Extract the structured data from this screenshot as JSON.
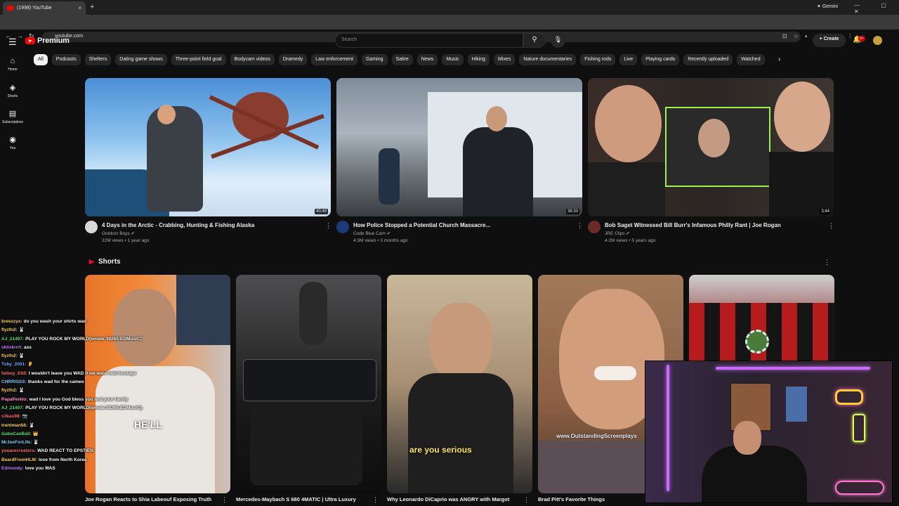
{
  "browser": {
    "tab_title": "(1998) YouTube",
    "tab_close": "×",
    "new_tab": "+",
    "gemini_label": "Gemini",
    "url": "youtube.com",
    "window_controls": "— ▢ ✕"
  },
  "header": {
    "menu_icon": "☰",
    "logo_text": "Premium",
    "search_placeholder": "Search",
    "create_label": "Create",
    "notification_badge": "9+"
  },
  "sidebar": [
    {
      "icon": "⌂",
      "label": "Home"
    },
    {
      "icon": "◈",
      "label": "Shorts"
    },
    {
      "icon": "▤",
      "label": "Subscriptions"
    },
    {
      "icon": "◉",
      "label": "You"
    }
  ],
  "chips": [
    "All",
    "Podcasts",
    "Shelters",
    "Dating game shows",
    "Three-point field goal",
    "Bodycam videos",
    "Dramedy",
    "Law enforcement",
    "Gaming",
    "Satire",
    "News",
    "Music",
    "Hiking",
    "Mixes",
    "Nature documentaries",
    "Fishing rods",
    "Live",
    "Playing cards",
    "Recently uploaded",
    "Watched"
  ],
  "videos": [
    {
      "title": "4 Days in the Arctic - Crabbing, Hunting & Fishing Alaska",
      "channel": "Outdoor Boys",
      "meta": "22M views • 1 year ago",
      "duration": "40:49"
    },
    {
      "title": "How Police Stopped a Potential Church Massacre...",
      "channel": "Code Blue Cam",
      "meta": "4.3M views • 3 months ago",
      "duration": "38:33"
    },
    {
      "title": "Bob Saget Witnessed Bill Burr's Infamous Philly Rant | Joe Rogan",
      "channel": "JRE Clips",
      "meta": "4.2M views • 5 years ago",
      "duration": "3:44"
    }
  ],
  "shorts": {
    "heading": "Shorts",
    "items": [
      {
        "title": "Joe Rogan Reacts to Shia Labeouf Exposing Truth",
        "caption": "HE'LL"
      },
      {
        "title": "Mercedes-Maybach S 680 4MATIC | Ultra Luxury",
        "caption": ""
      },
      {
        "title": "Why Leonardo DiCaprio was ANGRY with Margot",
        "caption": "are you serious"
      },
      {
        "title": "Brad Pitt's Favorite Things",
        "caption": "www.OutstandingScreenplays"
      },
      {
        "title": "",
        "caption": ""
      }
    ]
  },
  "chat": [
    {
      "user": "breezzyx:",
      "color": "#ffd34d",
      "msg": "do you wash your shirts wad"
    },
    {
      "user": "flyzfn2:",
      "color": "#ffd34d",
      "msg": "🐰"
    },
    {
      "user": "AJ_21407:",
      "color": "#4be36f",
      "msg": "PLAY YOU ROCK MY WORLD[emote:39265:EDMusiC]"
    },
    {
      "user": "skilskrrrt:",
      "color": "#c77dff",
      "msg": "ass"
    },
    {
      "user": "flyzfn2:",
      "color": "#ffd34d",
      "msg": "🐰"
    },
    {
      "user": "Toby_2001:",
      "color": "#6ea8ff",
      "msg": "👂"
    },
    {
      "user": "fatboy_E69:",
      "color": "#ff6b6b",
      "msg": "I wouldn't leave you WAD if we were held hostage"
    },
    {
      "user": "CHRRISSS:",
      "color": "#7ad0ff",
      "msg": "thanks wad for the cameo"
    },
    {
      "user": "flyzfn2:",
      "color": "#ffd34d",
      "msg": "🐰"
    },
    {
      "user": "PapaPerkio:",
      "color": "#ff8fd0",
      "msg": "wad I love you God bless you and your family"
    },
    {
      "user": "AJ_21407:",
      "color": "#4be36f",
      "msg": "PLAY YOU ROCK MY WORLD[emote:39265:EDMusiC]."
    },
    {
      "user": "s3kas98:",
      "color": "#ff6b6b",
      "msg": "📷"
    },
    {
      "user": "trentman56:",
      "color": "#ffd34d",
      "msg": "🐰"
    },
    {
      "user": "GabeCanBall:",
      "color": "#4be36f",
      "msg": "👑"
    },
    {
      "user": "MrJoeForLife:",
      "color": "#7ad0ff",
      "msg": "🐰"
    },
    {
      "user": "youarecreators:",
      "color": "#ff6b6b",
      "msg": "WAD REACT TO EPSTIEN"
    },
    {
      "user": "BeardFromHLM:",
      "color": "#ffd34d",
      "msg": "love from North Korea"
    },
    {
      "user": "Edmoody:",
      "color": "#c77dff",
      "msg": "love you WAS"
    }
  ]
}
